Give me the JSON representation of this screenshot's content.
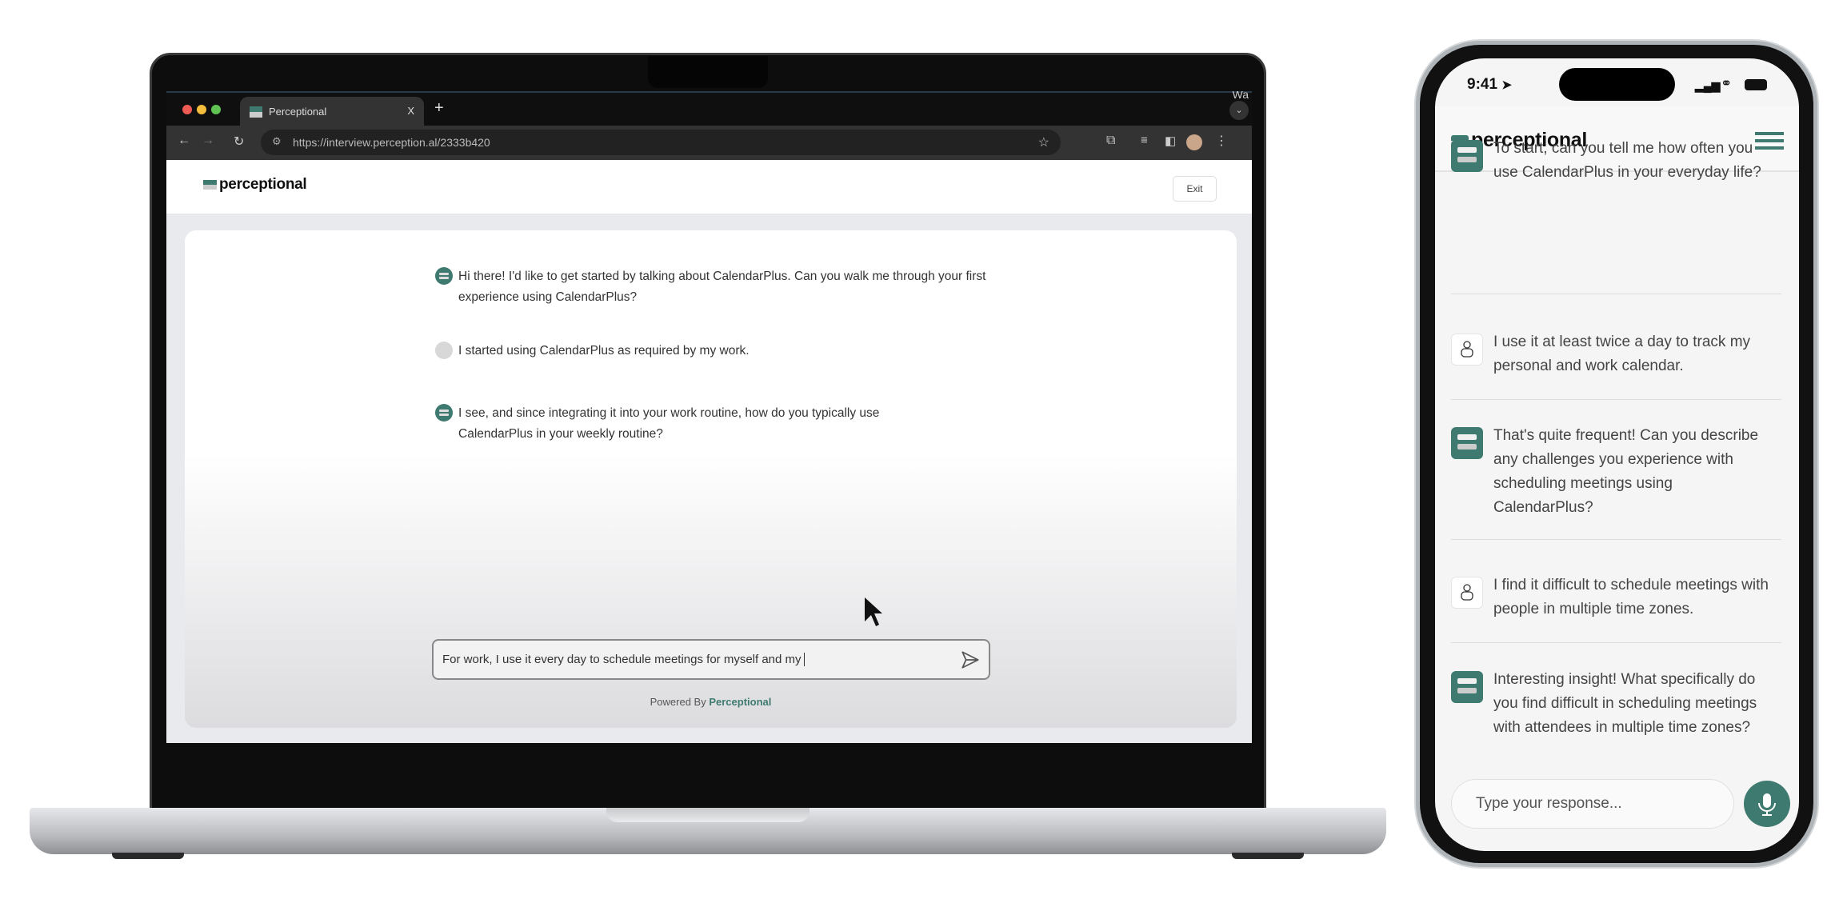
{
  "colors": {
    "brand": "#3f7a70"
  },
  "laptop": {
    "browser": {
      "tab_title": "Perceptional",
      "new_tab": "+",
      "tab_close": "X",
      "url": "https://interview.perception.al/2333b420",
      "corner_text": "Wa"
    },
    "header": {
      "logo": "perceptional",
      "exit_label": "Exit"
    },
    "messages": [
      {
        "role": "bot",
        "text": "Hi there! I'd like to get started by talking about CalendarPlus. Can you walk me through your first experience using CalendarPlus?"
      },
      {
        "role": "user",
        "text": "I started using CalendarPlus as required by my work."
      },
      {
        "role": "bot",
        "text": "I see, and since integrating it into your work routine, how do you typically use CalendarPlus in your weekly routine?"
      }
    ],
    "input_value": "For work, I use it every day to schedule meetings for myself and my",
    "powered_prefix": "Powered By",
    "powered_brand": "Perceptional"
  },
  "phone": {
    "status": {
      "time": "9:41"
    },
    "header": {
      "logo": "perceptional"
    },
    "messages": [
      {
        "role": "bot",
        "text": "To start, can you tell me how often you use CalendarPlus in your everyday life?"
      },
      {
        "role": "user",
        "text": "I use it at least twice a day to track my personal and work calendar."
      },
      {
        "role": "bot",
        "text": "That's quite frequent! Can you describe any challenges you experience with scheduling meetings using CalendarPlus?"
      },
      {
        "role": "user",
        "text": "I find it difficult to schedule meetings with people in multiple time zones."
      },
      {
        "role": "bot",
        "text": "Interesting insight! What specifically do you find difficult in scheduling meetings with attendees in multiple time zones?"
      }
    ],
    "input_placeholder": "Type your response..."
  }
}
